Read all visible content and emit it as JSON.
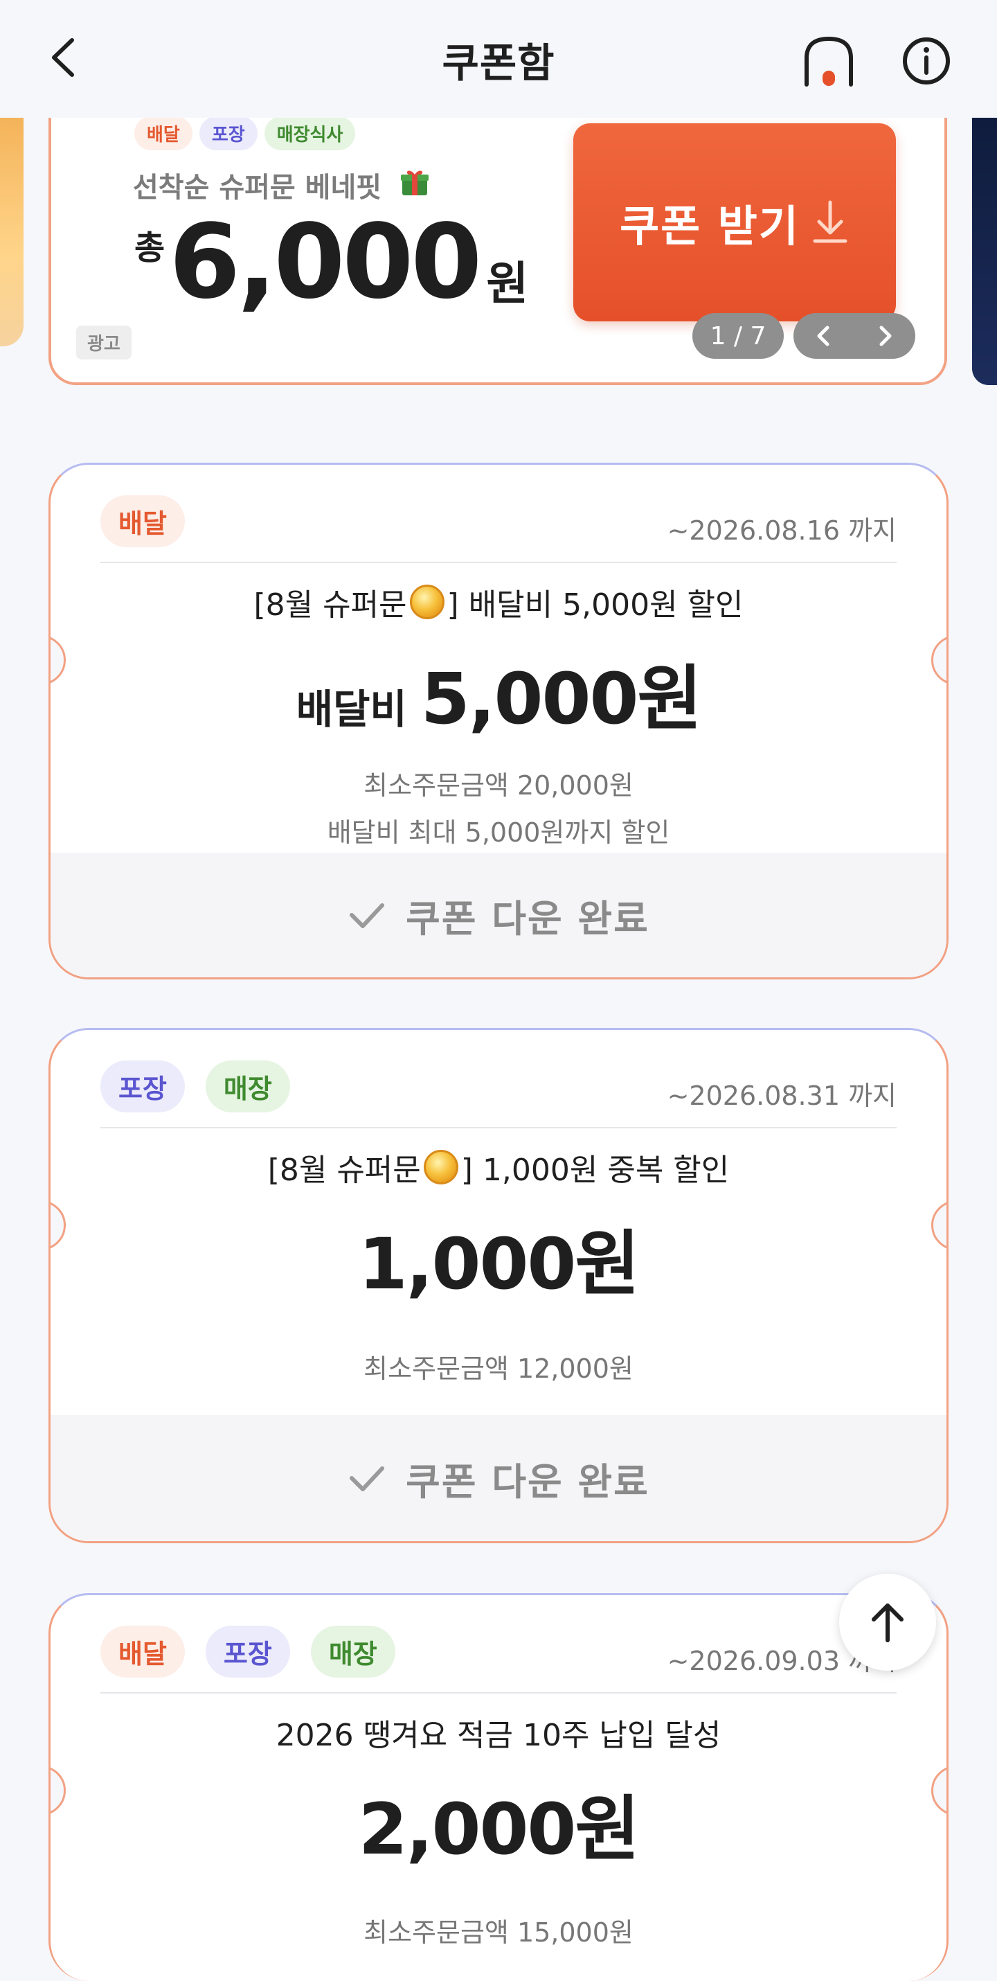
{
  "header": {
    "title": "쿠폰함",
    "back_icon": "chevron-left-icon",
    "home_icon": "home-icon",
    "info_icon": "info-icon",
    "accent": "#e5502a"
  },
  "banner": {
    "tags": [
      "배달",
      "포장",
      "매장식사"
    ],
    "subtitle": "선착순 슈퍼문 베네핏",
    "total_label": "총",
    "amount": "6,000",
    "currency": "원",
    "button_label": "쿠폰 받기",
    "ad_label": "광고",
    "pager": "1 / 7",
    "button_color": "#e5502a"
  },
  "coupons": [
    {
      "chips": [
        "배달"
      ],
      "expiry": "~2026.08.16 까지",
      "name_prefix": "[8월 슈퍼문",
      "name_suffix": "] 배달비 5,000원 할인",
      "value_prefix": "배달비",
      "value": "5,000원",
      "conditions": [
        "최소주문금액 20,000원",
        "배달비 최대 5,000원까지 할인"
      ],
      "status": "쿠폰 다운 완료"
    },
    {
      "chips": [
        "포장",
        "매장"
      ],
      "expiry": "~2026.08.31 까지",
      "name_prefix": "[8월 슈퍼문",
      "name_suffix": "] 1,000원 중복 할인",
      "value": "1,000원",
      "conditions": [
        "최소주문금액 12,000원"
      ],
      "status": "쿠폰 다운 완료"
    },
    {
      "chips": [
        "배달",
        "포장",
        "매장"
      ],
      "expiry": "~2026.09.03 까지",
      "name": "2026 땡겨요 적금 10주 납입 달성",
      "value": "2,000원",
      "conditions": [
        "최소주문금액 15,000원"
      ]
    }
  ],
  "scroll_top_icon": "arrow-up-icon"
}
